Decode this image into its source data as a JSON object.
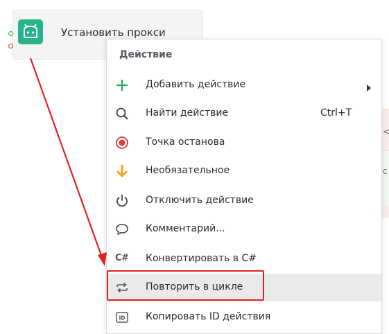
{
  "node": {
    "title": "Установить прокси",
    "icon": "android-icon",
    "icon_color": "#27b48a"
  },
  "side_fragments": {
    "glyph_a": "<",
    "glyph_b": "с"
  },
  "menu": {
    "header": "Действие",
    "items": [
      {
        "label": "Добавить действие",
        "icon": "plus-icon",
        "has_submenu": true
      },
      {
        "label": "Найти действие",
        "icon": "search-icon",
        "shortcut": "Ctrl+T"
      },
      {
        "label": "Точка останова",
        "icon": "breakpoint-icon"
      },
      {
        "label": "Необязательное",
        "icon": "arrow-down-icon"
      },
      {
        "label": "Отключить действие",
        "icon": "power-icon"
      },
      {
        "label": "Комментарий...",
        "icon": "comment-icon"
      },
      {
        "label": "Конвертировать в C#",
        "icon": "csharp-icon",
        "glyph": "C#"
      },
      {
        "label": "Повторить в цикле",
        "icon": "loop-icon",
        "hovered": true
      },
      {
        "label": "Копировать ID действия",
        "icon": "id-icon",
        "glyph": "ID"
      }
    ]
  },
  "annotation": {
    "color": "#e32020",
    "target": "Повторить в цикле"
  },
  "colors": {
    "plus": "#2aa35a",
    "breakpoint": "#e53935",
    "optional_arrow": "#f5a623",
    "hover_bg": "#e9eaec",
    "menu_header": "#555b63"
  }
}
